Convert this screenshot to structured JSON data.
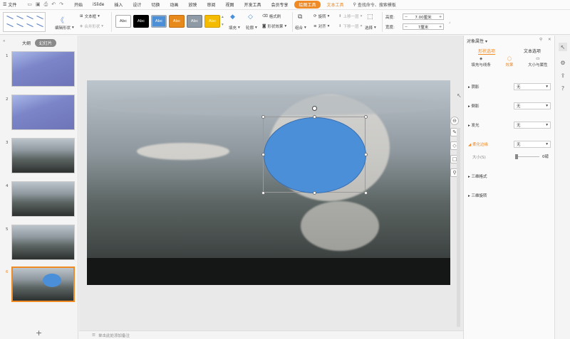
{
  "menu": {
    "file": "文件",
    "items": [
      "开始",
      "iSlide",
      "插入",
      "设计",
      "切换",
      "动画",
      "放映",
      "审阅",
      "视图",
      "开发工具",
      "会员专享"
    ],
    "highlight": "绘图工具",
    "text_tool": "文本工具",
    "search": "查找命令、搜索模板"
  },
  "ribbon": {
    "edit_shape": "编辑形状",
    "textbox": "文本框",
    "merge_shape": "合并形状",
    "style_label": "Abc",
    "fill": "填充",
    "outline": "轮廓",
    "format_painter": "格式刷",
    "shape_effects": "形状效果",
    "combine": "组合",
    "rotate": "旋转",
    "align": "对齐",
    "bring_forward": "上移一层",
    "send_backward": "下移一层",
    "select": "选择",
    "height_label": "高度:",
    "height_value": "7.00厘米",
    "width_label": "宽度:",
    "width_value": "7厘米",
    "colors": {
      "s1": "#ffffff",
      "s2": "#000000",
      "s3": "#4a8fd8",
      "s4": "#e8891c",
      "s5": "#8e9aa6",
      "s6": "#f5bb00"
    }
  },
  "left_panel": {
    "tab_outline": "大纲",
    "tab_slides": "幻灯片",
    "slides": [
      {
        "num": "1",
        "style": "blue"
      },
      {
        "num": "2",
        "style": "blue"
      },
      {
        "num": "3",
        "style": "sky"
      },
      {
        "num": "4",
        "style": "sky"
      },
      {
        "num": "5",
        "style": "sky"
      },
      {
        "num": "6",
        "style": "sky",
        "selected": true
      }
    ],
    "add": "+"
  },
  "notes": "单击此处添加备注",
  "right_panel": {
    "title": "对象属性",
    "tab_shape": "形状选项",
    "tab_text": "文本选项",
    "sub_fill": "填充与线条",
    "sub_effects": "效果",
    "sub_size": "大小与属性",
    "rows": [
      {
        "label": "阴影",
        "value": "无"
      },
      {
        "label": "倒影",
        "value": "无"
      },
      {
        "label": "发光",
        "value": "无"
      },
      {
        "label": "柔化边缘",
        "value": "无"
      }
    ],
    "size_label": "大小(S)",
    "size_value": "0磅",
    "bevel": "三维格式",
    "rotation": "三维旋转"
  }
}
